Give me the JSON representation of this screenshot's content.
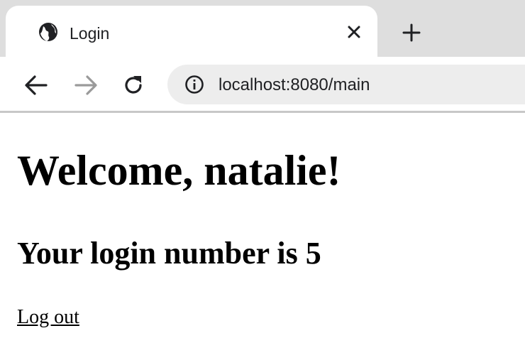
{
  "browser": {
    "tab": {
      "title": "Login",
      "icon": "globe-icon",
      "close_icon": "close-icon"
    },
    "new_tab_icon": "plus-icon",
    "toolbar": {
      "back_icon": "back-arrow-icon",
      "forward_icon": "forward-arrow-icon",
      "reload_icon": "reload-icon",
      "site_info_icon": "info-icon",
      "url": "localhost:8080/main"
    }
  },
  "page": {
    "heading": "Welcome, natalie!",
    "subheading": "Your login number is 5",
    "logout_link": "Log out"
  },
  "colors": {
    "tabstrip_bg": "#dedede",
    "omnibox_bg": "#ededed",
    "text": "#000000"
  }
}
